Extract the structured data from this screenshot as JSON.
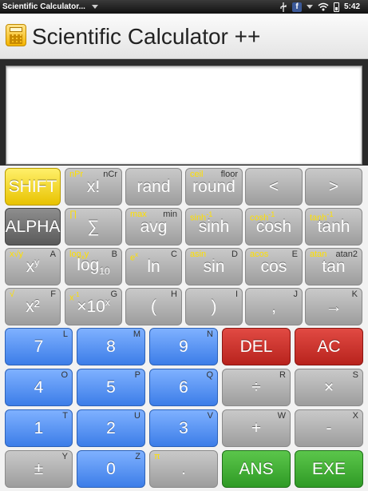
{
  "status": {
    "app_name": "Scientific Calculator...",
    "time": "5:42",
    "icons": [
      "usb-icon",
      "facebook-icon",
      "wifi-icon",
      "battery-icon"
    ]
  },
  "header": {
    "title": "Scientific Calculator ++",
    "icon": "calculator-icon"
  },
  "display": {
    "value": ""
  },
  "colors": {
    "yellow": "#f4d400",
    "gray": "#b0b0b0",
    "dark": "#707070",
    "blue": "#4a88ee",
    "red": "#c8302a",
    "green": "#3fae33",
    "subtext_yellow": "#ffe000"
  },
  "keys": {
    "shift": {
      "main": "SHIFT"
    },
    "fact": {
      "main": "x!",
      "left": "nPr",
      "right": "nCr"
    },
    "rand": {
      "main": "rand"
    },
    "round": {
      "main": "round",
      "left": "ceil",
      "right": "floor"
    },
    "lt": {
      "main": "<"
    },
    "gt": {
      "main": ">"
    },
    "alpha": {
      "main": "ALPHA"
    },
    "sum": {
      "main": "∑",
      "left": "∏"
    },
    "avg": {
      "main": "avg",
      "left": "max",
      "right": "min"
    },
    "sinh": {
      "main": "sinh",
      "left_base": "sinh",
      "left_sup": "-1"
    },
    "cosh": {
      "main": "cosh",
      "left_base": "cosh",
      "left_sup": "-1"
    },
    "tanh": {
      "main": "tanh",
      "left_base": "tanh",
      "left_sup": "-1"
    },
    "pow": {
      "main_base": "x",
      "main_sup": "y",
      "left": "x√y",
      "right": "A"
    },
    "log": {
      "main_base": "log",
      "main_sub": "10",
      "left_base": "log",
      "left_sub": "x",
      "left_tail": "y",
      "right": "B"
    },
    "ln": {
      "main": "ln",
      "left_base": "e",
      "left_sup": "x",
      "right": "C"
    },
    "sin": {
      "main": "sin",
      "left": "asin",
      "right": "D"
    },
    "cos": {
      "main": "cos",
      "left": "acos",
      "right": "E"
    },
    "tan": {
      "main": "tan",
      "left": "atan",
      "right": "atan2"
    },
    "sq": {
      "main": "x²",
      "left": "√",
      "right": "F"
    },
    "exp10": {
      "main_base": "×10",
      "main_sup": "x",
      "left_base": "x",
      "left_sup": "-1",
      "right": "G"
    },
    "lparen": {
      "main": "(",
      "right": "H"
    },
    "rparen": {
      "main": ")",
      "right": "I"
    },
    "comma": {
      "main": ",",
      "right": "J"
    },
    "arrow": {
      "main": "→",
      "right": "K"
    },
    "n7": {
      "main": "7",
      "right": "L"
    },
    "n8": {
      "main": "8",
      "right": "M"
    },
    "n9": {
      "main": "9",
      "right": "N"
    },
    "del": {
      "main": "DEL"
    },
    "ac": {
      "main": "AC"
    },
    "n4": {
      "main": "4",
      "right": "O"
    },
    "n5": {
      "main": "5",
      "right": "P"
    },
    "n6": {
      "main": "6",
      "right": "Q"
    },
    "div": {
      "main": "÷",
      "right": "R"
    },
    "mul": {
      "main": "×",
      "right": "S"
    },
    "n1": {
      "main": "1",
      "right": "T"
    },
    "n2": {
      "main": "2",
      "right": "U"
    },
    "n3": {
      "main": "3",
      "right": "V"
    },
    "add": {
      "main": "+",
      "right": "W"
    },
    "sub": {
      "main": "-",
      "right": "X"
    },
    "neg": {
      "main": "±",
      "right": "Y"
    },
    "n0": {
      "main": "0",
      "right": "Z"
    },
    "dot": {
      "main": ".",
      "left": "π"
    },
    "ans": {
      "main": "ANS"
    },
    "exe": {
      "main": "EXE"
    }
  }
}
